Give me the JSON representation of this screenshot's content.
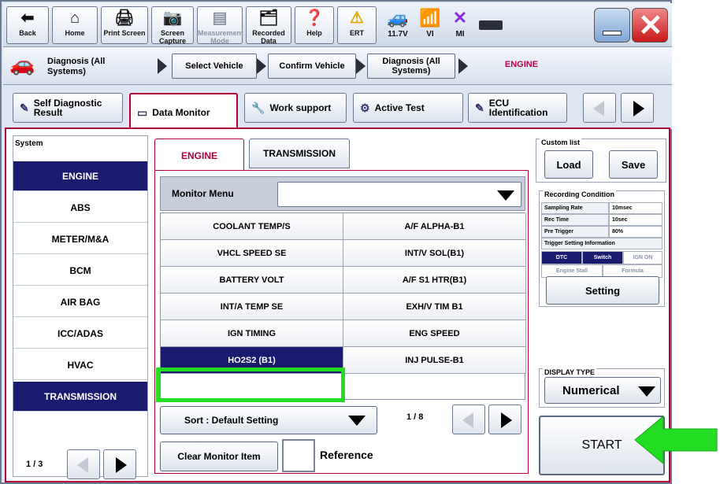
{
  "toolbar": {
    "back": "Back",
    "home": "Home",
    "print_screen": "Print Screen",
    "screen_capture": "Screen Capture",
    "measurement_mode": "Measurement Mode",
    "recorded_data": "Recorded Data",
    "help": "Help",
    "ert": "ERT",
    "voltage": "11.7V",
    "vi": "VI",
    "mi": "MI"
  },
  "breadcrumb": {
    "first": "Diagnosis (All Systems)",
    "steps": [
      "Select Vehicle",
      "Confirm Vehicle",
      "Diagnosis (All Systems)"
    ],
    "current": "ENGINE"
  },
  "tabs": [
    "Self Diagnostic Result",
    "Data Monitor",
    "Work support",
    "Active Test",
    "ECU Identification"
  ],
  "active_tab": "Data Monitor",
  "system": {
    "header": "System",
    "items": [
      "ENGINE",
      "ABS",
      "METER/M&A",
      "BCM",
      "AIR BAG",
      "ICC/ADAS",
      "HVAC",
      "TRANSMISSION"
    ],
    "page": "1 / 3"
  },
  "subtabs": [
    "ENGINE",
    "TRANSMISSION"
  ],
  "monitor_menu": {
    "label": "Monitor Menu",
    "value": ""
  },
  "monitor_items": [
    [
      "COOLANT TEMP/S",
      "A/F ALPHA-B1"
    ],
    [
      "VHCL SPEED SE",
      "INT/V SOL(B1)"
    ],
    [
      "BATTERY VOLT",
      "A/F S1 HTR(B1)"
    ],
    [
      "INT/A TEMP SE",
      "EXH/V TIM B1"
    ],
    [
      "IGN TIMING",
      "ENG SPEED"
    ],
    [
      "HO2S2 (B1)",
      "INJ PULSE-B1"
    ]
  ],
  "sort": {
    "label": "Sort : Default Setting",
    "page": "1 / 8"
  },
  "clear_button": "Clear Monitor Item",
  "reference_label": "Reference",
  "custom_list": {
    "title": "Custom list",
    "load": "Load",
    "save": "Save"
  },
  "recording": {
    "title": "Recording Condition",
    "rows": [
      [
        "Sampling Rate",
        "10msec"
      ],
      [
        "Rec Time",
        "10sec"
      ],
      [
        "Pre Trigger",
        "80%"
      ]
    ],
    "trigger_title": "Trigger Setting Information",
    "trigger_row1": [
      "DTC",
      "Switch",
      "IGN ON"
    ],
    "trigger_row2": [
      "Engine Stall",
      "Formula"
    ],
    "setting": "Setting"
  },
  "display_type": {
    "title": "DISPLAY TYPE",
    "value": "Numerical"
  },
  "start": "START",
  "colors": {
    "accent": "#b0003a",
    "selected": "#1a1a6e",
    "highlight": "#22dd22"
  }
}
